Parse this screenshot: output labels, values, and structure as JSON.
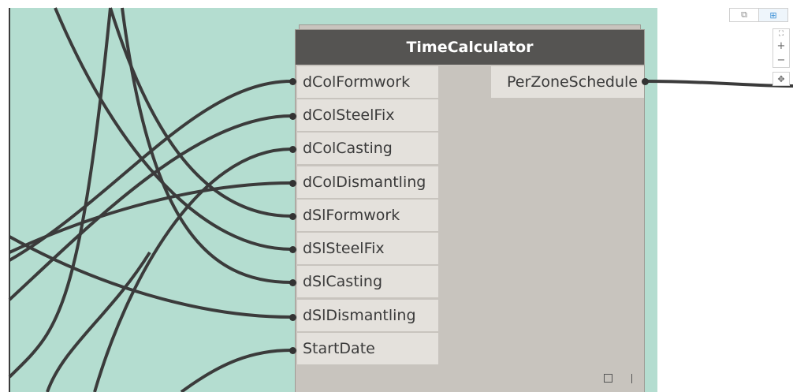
{
  "node": {
    "title": "TimeCalculator",
    "inputs": [
      {
        "label": "dColFormwork"
      },
      {
        "label": "dColSteelFix"
      },
      {
        "label": "dColCasting"
      },
      {
        "label": "dColDismantling"
      },
      {
        "label": "dSlFormwork"
      },
      {
        "label": "dSlSteelFix"
      },
      {
        "label": "dSlCasting"
      },
      {
        "label": "dSlDismantling"
      },
      {
        "label": "StartDate"
      }
    ],
    "output": {
      "label": "PerZoneSchedule"
    }
  },
  "controls": {
    "geometry_view_icon": "⧉",
    "graph_view_icon": "⊞",
    "zoom_fit_icon": "⛶",
    "zoom_in_icon": "+",
    "zoom_out_icon": "−",
    "pan_icon": "✥"
  },
  "colors": {
    "canvas_bg": "#b4ddd0",
    "node_header": "#555452",
    "node_body": "#c8c4be",
    "port_bg": "#e4e1dc",
    "wire": "#3b3b3b"
  }
}
